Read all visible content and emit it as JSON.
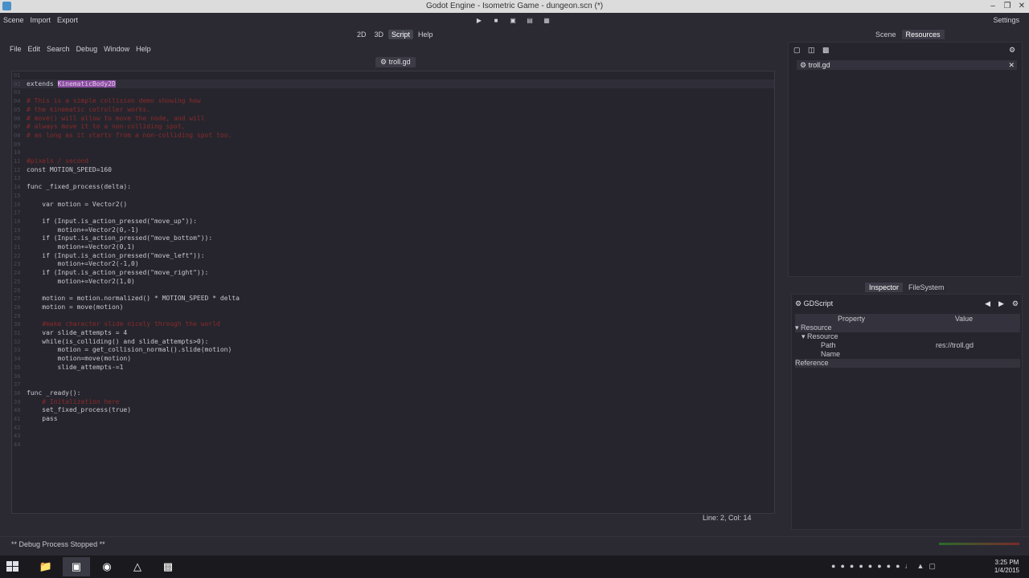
{
  "window": {
    "title": "Godot Engine - Isometric Game - dungeon.scn (*)"
  },
  "topmenu": [
    "Scene",
    "Import",
    "Export"
  ],
  "settings_label": "Settings",
  "modes": [
    {
      "label": "2D"
    },
    {
      "label": "3D"
    },
    {
      "label": "Script",
      "active": true
    },
    {
      "label": "Help"
    }
  ],
  "dock_tabs_top": [
    {
      "label": "Scene"
    },
    {
      "label": "Resources",
      "active": true
    }
  ],
  "script_menu": [
    "File",
    "Edit",
    "Search",
    "Debug",
    "Window",
    "Help"
  ],
  "open_file": "troll.gd",
  "code": [
    {
      "n": "01",
      "t": ""
    },
    {
      "n": "02",
      "t": "extends KinematicBody2D"
    },
    {
      "n": "03",
      "t": ""
    },
    {
      "n": "04",
      "t": "# This is a simple collision demo showing how"
    },
    {
      "n": "05",
      "t": "# the kinematic cotroller works."
    },
    {
      "n": "06",
      "t": "# move() will allow to move the node, and will"
    },
    {
      "n": "07",
      "t": "# always move it to a non-colliding spot,"
    },
    {
      "n": "08",
      "t": "# as long as it starts from a non-colliding spot too."
    },
    {
      "n": "09",
      "t": ""
    },
    {
      "n": "10",
      "t": ""
    },
    {
      "n": "11",
      "t": "#pixels / second"
    },
    {
      "n": "12",
      "t": "const MOTION_SPEED=160"
    },
    {
      "n": "13",
      "t": ""
    },
    {
      "n": "14",
      "t": "func _fixed_process(delta):"
    },
    {
      "n": "15",
      "t": ""
    },
    {
      "n": "16",
      "t": "    var motion = Vector2()"
    },
    {
      "n": "17",
      "t": ""
    },
    {
      "n": "18",
      "t": "    if (Input.is_action_pressed(\"move_up\")):"
    },
    {
      "n": "19",
      "t": "        motion+=Vector2(0,-1)"
    },
    {
      "n": "20",
      "t": "    if (Input.is_action_pressed(\"move_bottom\")):"
    },
    {
      "n": "21",
      "t": "        motion+=Vector2(0,1)"
    },
    {
      "n": "22",
      "t": "    if (Input.is_action_pressed(\"move_left\")):"
    },
    {
      "n": "23",
      "t": "        motion+=Vector2(-1,0)"
    },
    {
      "n": "24",
      "t": "    if (Input.is_action_pressed(\"move_right\")):"
    },
    {
      "n": "25",
      "t": "        motion+=Vector2(1,0)"
    },
    {
      "n": "26",
      "t": ""
    },
    {
      "n": "27",
      "t": "    motion = motion.normalized() * MOTION_SPEED * delta"
    },
    {
      "n": "28",
      "t": "    motion = move(motion)"
    },
    {
      "n": "29",
      "t": ""
    },
    {
      "n": "30",
      "t": "    #make character slide nicely through the world"
    },
    {
      "n": "31",
      "t": "    var slide_attempts = 4"
    },
    {
      "n": "32",
      "t": "    while(is_colliding() and slide_attempts>0):"
    },
    {
      "n": "33",
      "t": "        motion = get_collision_normal().slide(motion)"
    },
    {
      "n": "34",
      "t": "        motion=move(motion)"
    },
    {
      "n": "35",
      "t": "        slide_attempts-=1"
    },
    {
      "n": "36",
      "t": ""
    },
    {
      "n": "37",
      "t": ""
    },
    {
      "n": "38",
      "t": "func _ready():"
    },
    {
      "n": "39",
      "t": "    # Initalization here"
    },
    {
      "n": "40",
      "t": "    set_fixed_process(true)"
    },
    {
      "n": "41",
      "t": "    pass"
    },
    {
      "n": "42",
      "t": ""
    },
    {
      "n": "43",
      "t": ""
    },
    {
      "n": "44",
      "t": ""
    }
  ],
  "cursor_status": "Line: 2, Col: 14",
  "resources": {
    "item": "troll.gd"
  },
  "inspector_tabs": [
    {
      "label": "Inspector",
      "active": true
    },
    {
      "label": "FileSystem"
    }
  ],
  "inspector": {
    "object": "GDScript",
    "col_property": "Property",
    "col_value": "Value",
    "rows": [
      {
        "label": "▾ Resource",
        "value": "",
        "section": true,
        "indent": 0
      },
      {
        "label": "▾ Resource",
        "value": "",
        "section": false,
        "indent": 8
      },
      {
        "label": "Path",
        "value": "res://troll.gd",
        "section": false,
        "indent": 32
      },
      {
        "label": "Name",
        "value": "",
        "section": false,
        "indent": 32
      },
      {
        "label": "Reference",
        "value": "",
        "section": true,
        "indent": 0
      }
    ]
  },
  "debug_status": "** Debug Process Stopped **",
  "clock": {
    "time": "3:25 PM",
    "date": "1/4/2015"
  }
}
